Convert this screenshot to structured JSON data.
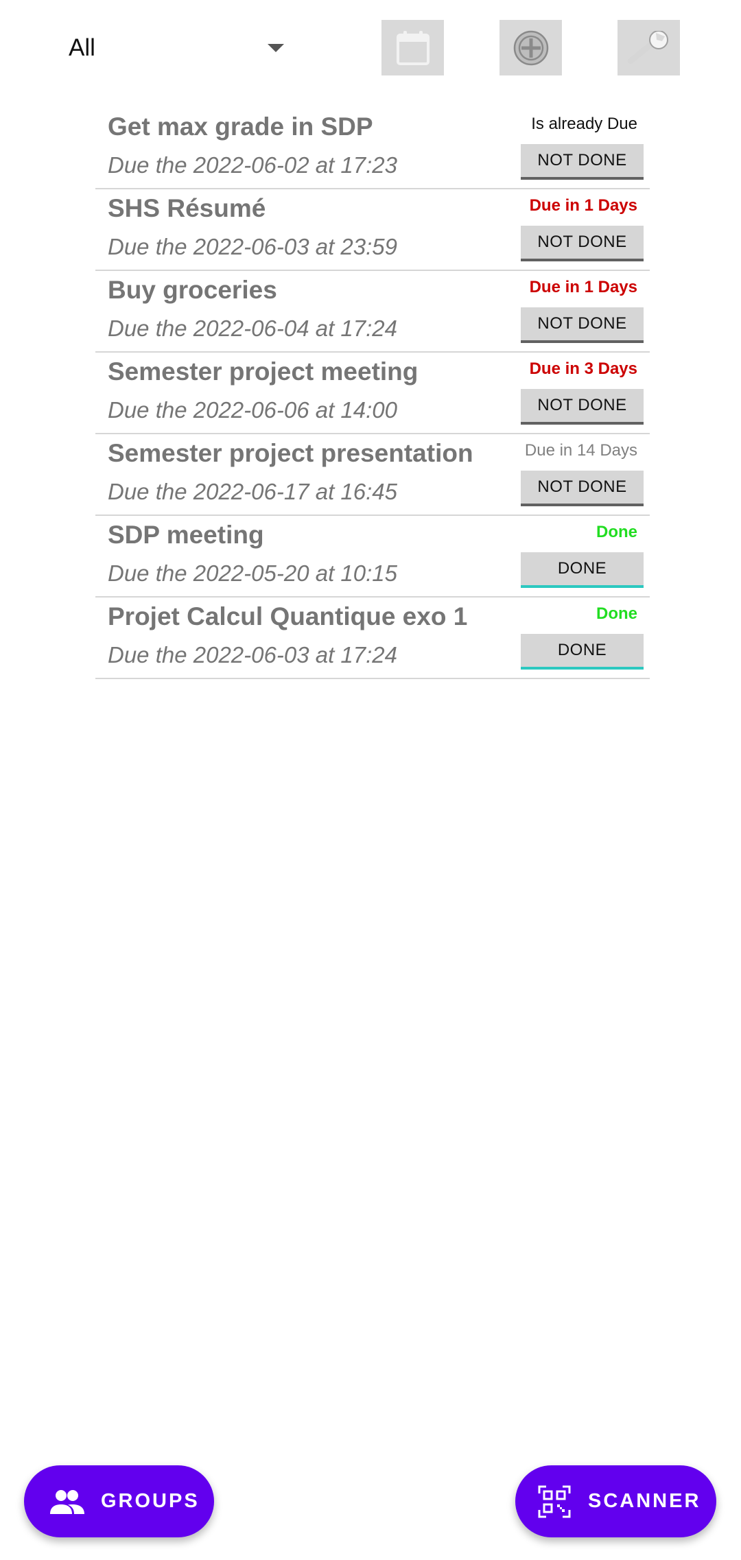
{
  "toolbar": {
    "filter": {
      "selected": "All"
    },
    "buttons": [
      {
        "name": "calendar",
        "icon": "calendar-icon"
      },
      {
        "name": "add",
        "icon": "add-circle-icon"
      },
      {
        "name": "settings",
        "icon": "wrench-icon"
      }
    ]
  },
  "tasks": [
    {
      "title": "Get max grade in SDP",
      "due": "Due the 2022-06-02 at 17:23",
      "status": "Is already Due",
      "status_kind": "overdue",
      "button": "NOT DONE",
      "done": false
    },
    {
      "title": "SHS Résumé",
      "due": "Due the 2022-06-03 at 23:59",
      "status": "Due in 1 Days",
      "status_kind": "soon",
      "button": "NOT DONE",
      "done": false
    },
    {
      "title": "Buy groceries",
      "due": "Due the 2022-06-04 at 17:24",
      "status": "Due in 1 Days",
      "status_kind": "soon",
      "button": "NOT DONE",
      "done": false
    },
    {
      "title": "Semester project meeting",
      "due": "Due the 2022-06-06 at 14:00",
      "status": "Due in 3 Days",
      "status_kind": "soon",
      "button": "NOT DONE",
      "done": false
    },
    {
      "title": "Semester project presentation",
      "due": "Due the 2022-06-17 at 16:45",
      "status": "Due in 14 Days",
      "status_kind": "later",
      "button": "NOT DONE",
      "done": false
    },
    {
      "title": "SDP meeting",
      "due": "Due the 2022-05-20 at 10:15",
      "status": "Done",
      "status_kind": "done",
      "button": "DONE",
      "done": true
    },
    {
      "title": "Projet Calcul Quantique exo 1",
      "due": "Due the 2022-06-03 at 17:24",
      "status": "Done",
      "status_kind": "done",
      "button": "DONE",
      "done": true
    }
  ],
  "fabs": {
    "groups": {
      "label": "GROUPS",
      "icon": "people-icon"
    },
    "scanner": {
      "label": "SCANNER",
      "icon": "qr-code-icon"
    }
  },
  "colors": {
    "accent": "#6200ee",
    "status_soon": "#cc0000",
    "status_done": "#22dd22",
    "done_underline": "#2cc8c0",
    "not_done_underline": "#616161"
  }
}
